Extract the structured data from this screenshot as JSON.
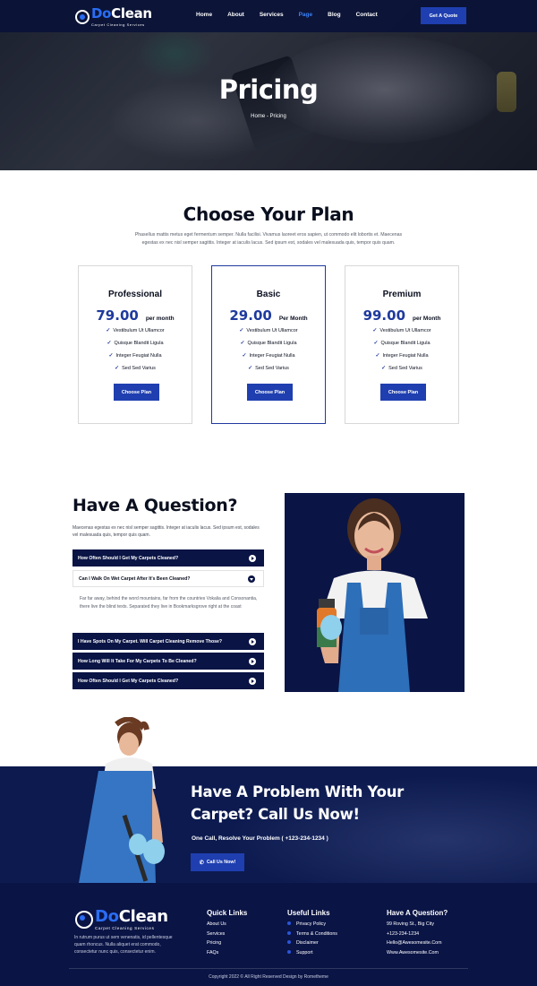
{
  "brand": {
    "name_part1": "Do",
    "name_part2": "Clean",
    "tagline": "Carpet Cleaning Services"
  },
  "nav": {
    "items": [
      "Home",
      "About",
      "Services",
      "Page",
      "Blog",
      "Contact"
    ],
    "active": "Page",
    "cta_label": "Get A Quote"
  },
  "hero": {
    "title": "Pricing",
    "breadcrumb": "Home - Pricing"
  },
  "plans": {
    "title": "Choose Your Plan",
    "description": "Phasellus mattis metus eget fermentum semper. Nulla facilisi. Vivamus laoreet eros sapien, ut commodo elit lobortis et. Maecenas egestas ex nec nisl semper sagittis. Integer at iaculis lacus. Sed ipsum est, sodales vel malesuada quis, tempor quis quam.",
    "cards": [
      {
        "name": "Professional",
        "price": "79.00",
        "per": "per month",
        "features": [
          "Vestibulum Ut Ullamcor",
          "Quisque Blandit Ligula",
          "Integer Feugiat Nulla",
          "Sed Sed Varius"
        ],
        "button": "Choose Plan"
      },
      {
        "name": "Basic",
        "price": "29.00",
        "per": "Per Month",
        "features": [
          "Vestibulum Ut Ullamcor",
          "Quisque Blandit Ligula",
          "Integer Feugiat Nulla",
          "Sed Sed Varius"
        ],
        "button": "Choose Plan"
      },
      {
        "name": "Premium",
        "price": "99.00",
        "per": "per Month",
        "features": [
          "Vestibulum Ut Ullamcor",
          "Quisque Blandit Ligula",
          "Integer Feugiat Nulla",
          "Sed Sed Varius"
        ],
        "button": "Choose Plan"
      }
    ],
    "featured_index": 1
  },
  "faq": {
    "title": "Have A Question?",
    "description": "Maecenas egestas ex nec nisl semper sagittis. Integer at iaculis lacus. Sed ipsum est, sodales vel malesuada quis, tempor quis quam.",
    "items": [
      "How Often Should I Get My Carpets Cleaned?",
      "Can I Walk On Wet Carpet After It's Been Cleaned?",
      "I Have Spots On My Carpet. Will Carpet Cleaning Remove Those?",
      "How Long Will It Take For My Carpets To Be Cleaned?",
      "How Often Should I Get My Carpets Cleaned?"
    ],
    "open_index": 1,
    "answer": "Far far away, behind the word mountains, far from the countries Vokalia and Consonantia, there live the blind texts. Separated they live in Bookmarksgrove right at the coast"
  },
  "cta": {
    "title": "Have A Problem With Your Carpet? Call Us Now!",
    "subtitle": "One Call, Resolve Your Problem ( +123-234-1234 )",
    "button": "Call Us Now!"
  },
  "footer": {
    "about": "In rutrum purus ut sem venenatis, id pellentesque quam rhoncus. Nulla aliquet erat commodo, consectetur nunc quis, consectetur enim.",
    "quick_links": {
      "title": "Quick Links",
      "items": [
        "About Us",
        "Services",
        "Pricing",
        "FAQs"
      ]
    },
    "useful_links": {
      "title": "Useful Links",
      "items": [
        "Privacy Policy",
        "Terms & Conditions",
        "Disclaimer",
        "Support"
      ]
    },
    "contact": {
      "title": "Have A Question?",
      "items": [
        "99 Roving St., Big City",
        "+123-234-1234",
        "Hello@Awesomesite.Com",
        "Www.Awesomesite.Com"
      ]
    },
    "copyright": "Copyright 2022 © All Right Reserved Design by Rometheme"
  },
  "colors": {
    "navy": "#0a1445",
    "accent_blue": "#1f3fb0",
    "price_blue": "#1f3a9e",
    "logo_blue": "#2a6df4"
  }
}
